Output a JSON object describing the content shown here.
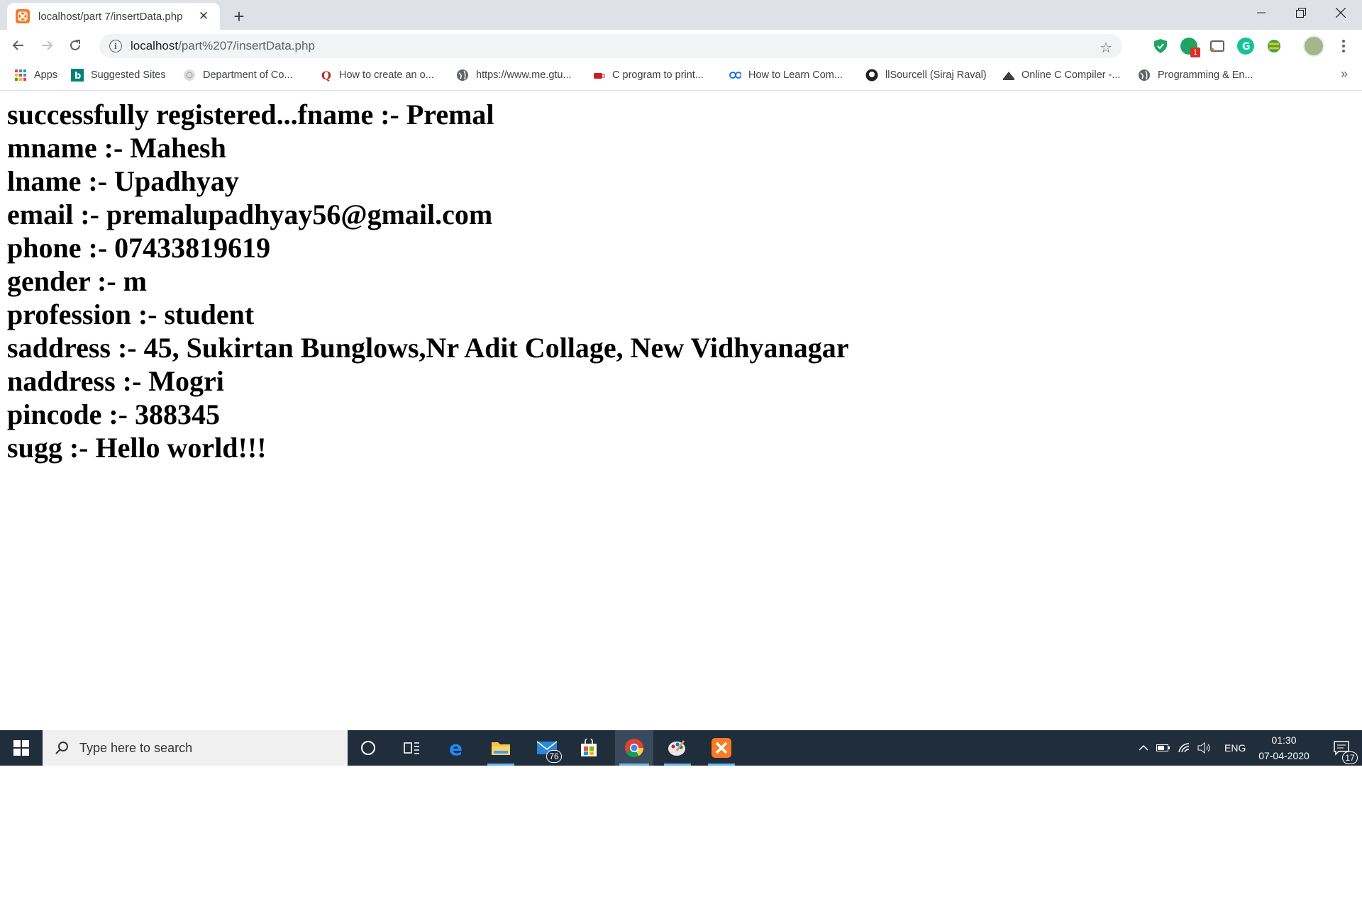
{
  "browser": {
    "tab": {
      "title": "localhost/part 7/insertData.php",
      "close_glyph": "✕",
      "favicon": "xampp-icon"
    },
    "new_tab_glyph": "+",
    "window_controls": {
      "minimize": "–",
      "maximize": "❐",
      "close": "✕"
    },
    "address": {
      "host": "localhost",
      "path": "/part%207/insertData.php"
    },
    "bookmarks": [
      {
        "label": "Apps",
        "icon": "apps-grid-icon"
      },
      {
        "label": "Suggested Sites",
        "icon": "bing-icon"
      },
      {
        "label": "Department of Co...",
        "icon": "globe-icon"
      },
      {
        "label": "How to create an o...",
        "icon": "quora-icon"
      },
      {
        "label": "https://www.me.gtu...",
        "icon": "globe-icon"
      },
      {
        "label": "C program to print...",
        "icon": "cup-icon"
      },
      {
        "label": "How to Learn Com...",
        "icon": "geeks-icon"
      },
      {
        "label": "llSourcell (Siraj Raval)",
        "icon": "github-icon"
      },
      {
        "label": "Online C Compiler -...",
        "icon": "compiler-icon"
      },
      {
        "label": "Programming & En...",
        "icon": "globe-icon"
      }
    ],
    "bookmarks_more": "»",
    "colors": {
      "tabstrip": "#dee1e6",
      "omnibox": "#f1f3f4",
      "favicon": "#f37a2d"
    }
  },
  "page": {
    "lines": [
      "successfully registered...fname :- Premal",
      "mname :- Mahesh",
      "lname :- Upadhyay",
      "email :- premalupadhyay56@gmail.com",
      "phone :- 07433819619",
      "gender :- m",
      "profession :- student",
      "saddress :- 45, Sukirtan Bunglows,Nr Adit Collage, New Vidhyanagar",
      "naddress :- Mogri",
      "pincode :- 388345",
      "sugg :- Hello world!!!"
    ]
  },
  "taskbar": {
    "search_placeholder": "Type here to search",
    "mail_badge": "76",
    "tray": {
      "language": "ENG"
    },
    "clock": {
      "time": "01:30",
      "date": "07-04-2020"
    },
    "notification_count": "17",
    "colors": {
      "background": "#202d3b",
      "accent": "#6ab4ee"
    }
  }
}
